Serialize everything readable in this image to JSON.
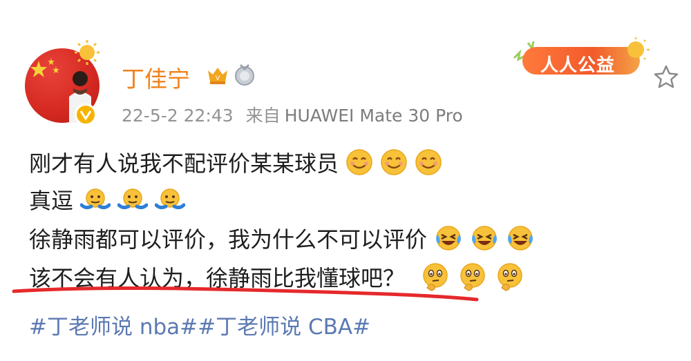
{
  "post": {
    "username": "丁佳宁",
    "date": "22-5-2 22:43",
    "source_prefix": "来自",
    "device": "HUAWEI Mate 30 Pro",
    "charity_badge": "人人公益",
    "lines": [
      "刚才有人说我不配评价某某球员",
      "真逗",
      "徐静雨都可以评价，我为什么不可以评价",
      "该不会有人认为，徐静雨比我懂球吧？"
    ],
    "hashtags": "#丁老师说 nba##丁老师说 CBA#"
  },
  "icons": {
    "avatar": "avatar-photo",
    "vip": "vip-crown-icon",
    "medal": "medal-icon",
    "star": "star-icon",
    "emoji_smile": "smile-emoji-icon",
    "emoji_shrug": "shrug-emoji-icon",
    "emoji_laughcry": "laugh-cry-emoji-icon",
    "emoji_thinking": "thinking-emoji-icon"
  },
  "colors": {
    "username": "#f0821a",
    "meta": "#939393",
    "hashtag": "#5b79b2",
    "underline": "#e5292b"
  }
}
